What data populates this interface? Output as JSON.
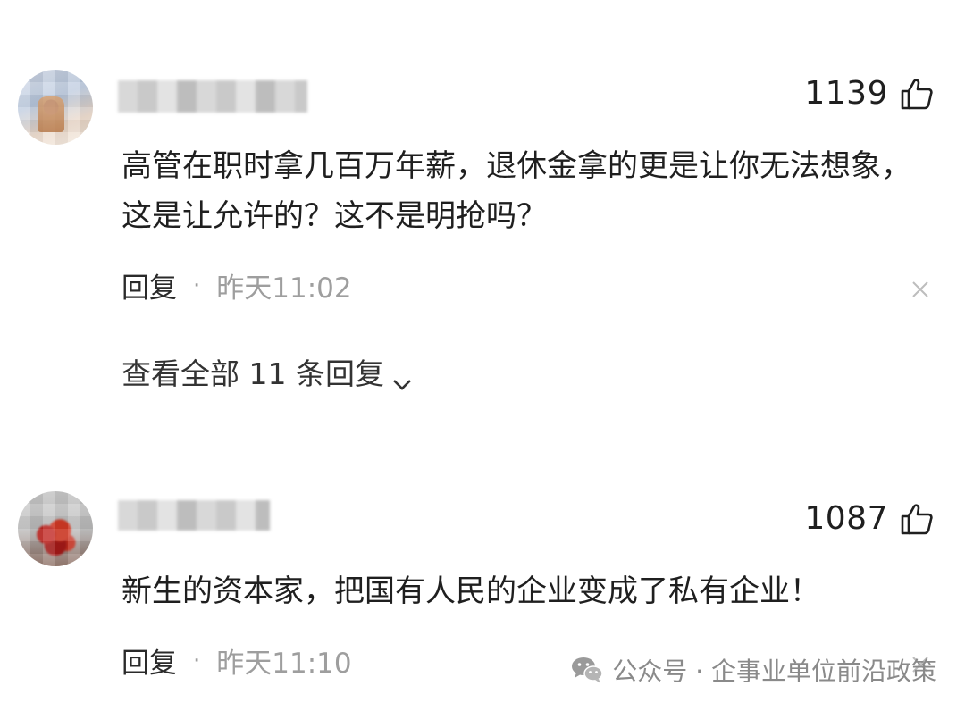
{
  "comments": [
    {
      "likes": "1139",
      "text": "高管在职时拿几百万年薪，退休金拿的更是让你无法想象，这是让允许的？这不是明抢吗？",
      "reply_label": "回复",
      "separator": "·",
      "time": "昨天11:02",
      "view_replies": "查看全部 11 条回复"
    },
    {
      "likes": "1087",
      "text": "新生的资本家，把国有人民的企业变成了私有企业！",
      "reply_label": "回复",
      "separator": "·",
      "time": "昨天11:10"
    }
  ],
  "watermark": {
    "text": "公众号 · 企事业单位前沿政策",
    "icon": "wechat-icon"
  },
  "colors": {
    "text": "#1f1f1f",
    "muted": "#9e9e9e",
    "background": "#ffffff"
  }
}
